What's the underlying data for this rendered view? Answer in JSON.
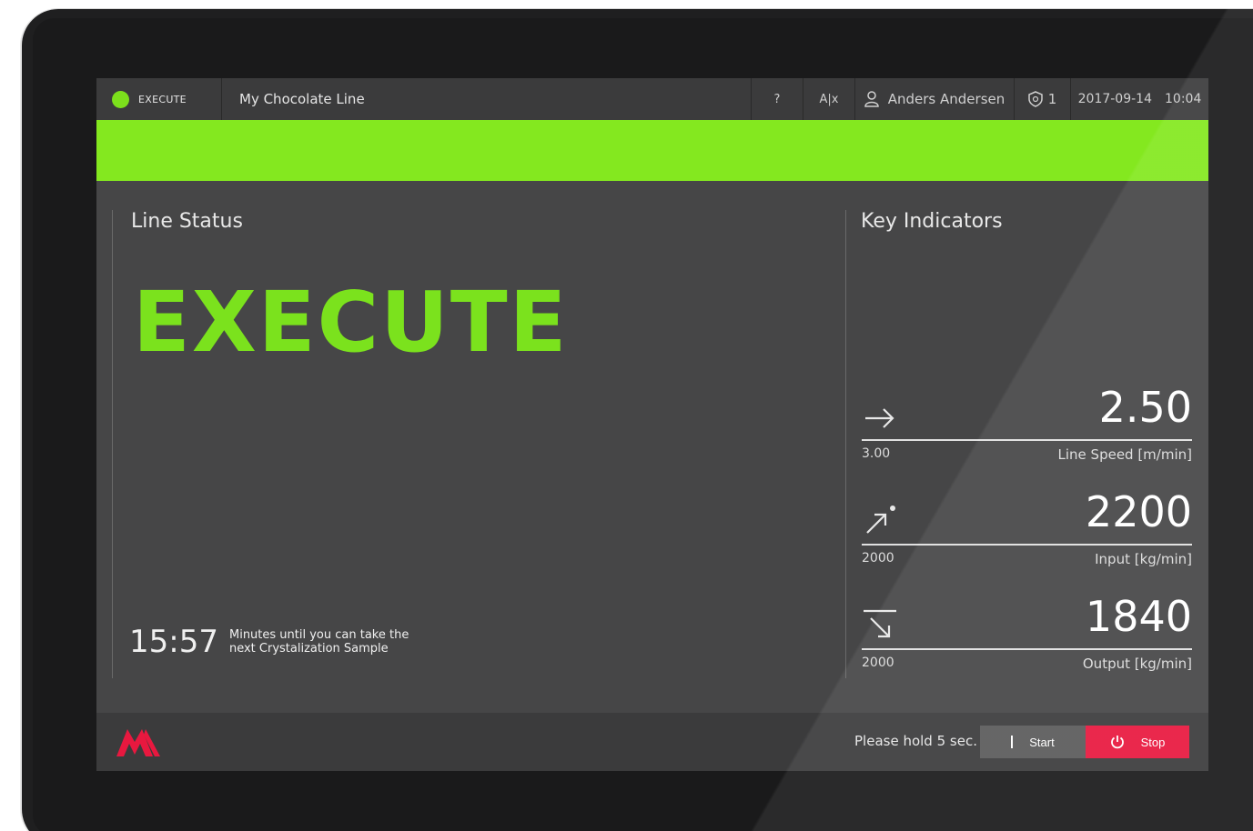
{
  "topbar": {
    "status_label": "EXECUTE",
    "line_name": "My Chocolate Line",
    "help_label": "?",
    "language_label": "A|x",
    "user_name": "Anders Andersen",
    "shield_count": "1",
    "date": "2017-09-14",
    "time": "10:04"
  },
  "colors": {
    "status_green": "#84e81f",
    "stop_red": "#e8183f",
    "logo_red": "#e8183f"
  },
  "line_status": {
    "title": "Line Status",
    "status": "EXECUTE",
    "timer_value": "15:57",
    "timer_text_line1": "Minutes until you can take the",
    "timer_text_line2": "next Crystalization Sample"
  },
  "key_indicators": {
    "title": "Key Indicators",
    "items": [
      {
        "icon": "arrow-right-icon",
        "value": "2.50",
        "target": "3.00",
        "label": "Line Speed [m/min]"
      },
      {
        "icon": "input-arrow-icon",
        "value": "2200",
        "target": "2000",
        "label": "Input [kg/min]"
      },
      {
        "icon": "output-arrow-icon",
        "value": "1840",
        "target": "2000",
        "label": "Output [kg/min]"
      }
    ]
  },
  "footer": {
    "hold_text": "Please hold 5 sec.",
    "start_label": "Start",
    "stop_label": "Stop"
  }
}
